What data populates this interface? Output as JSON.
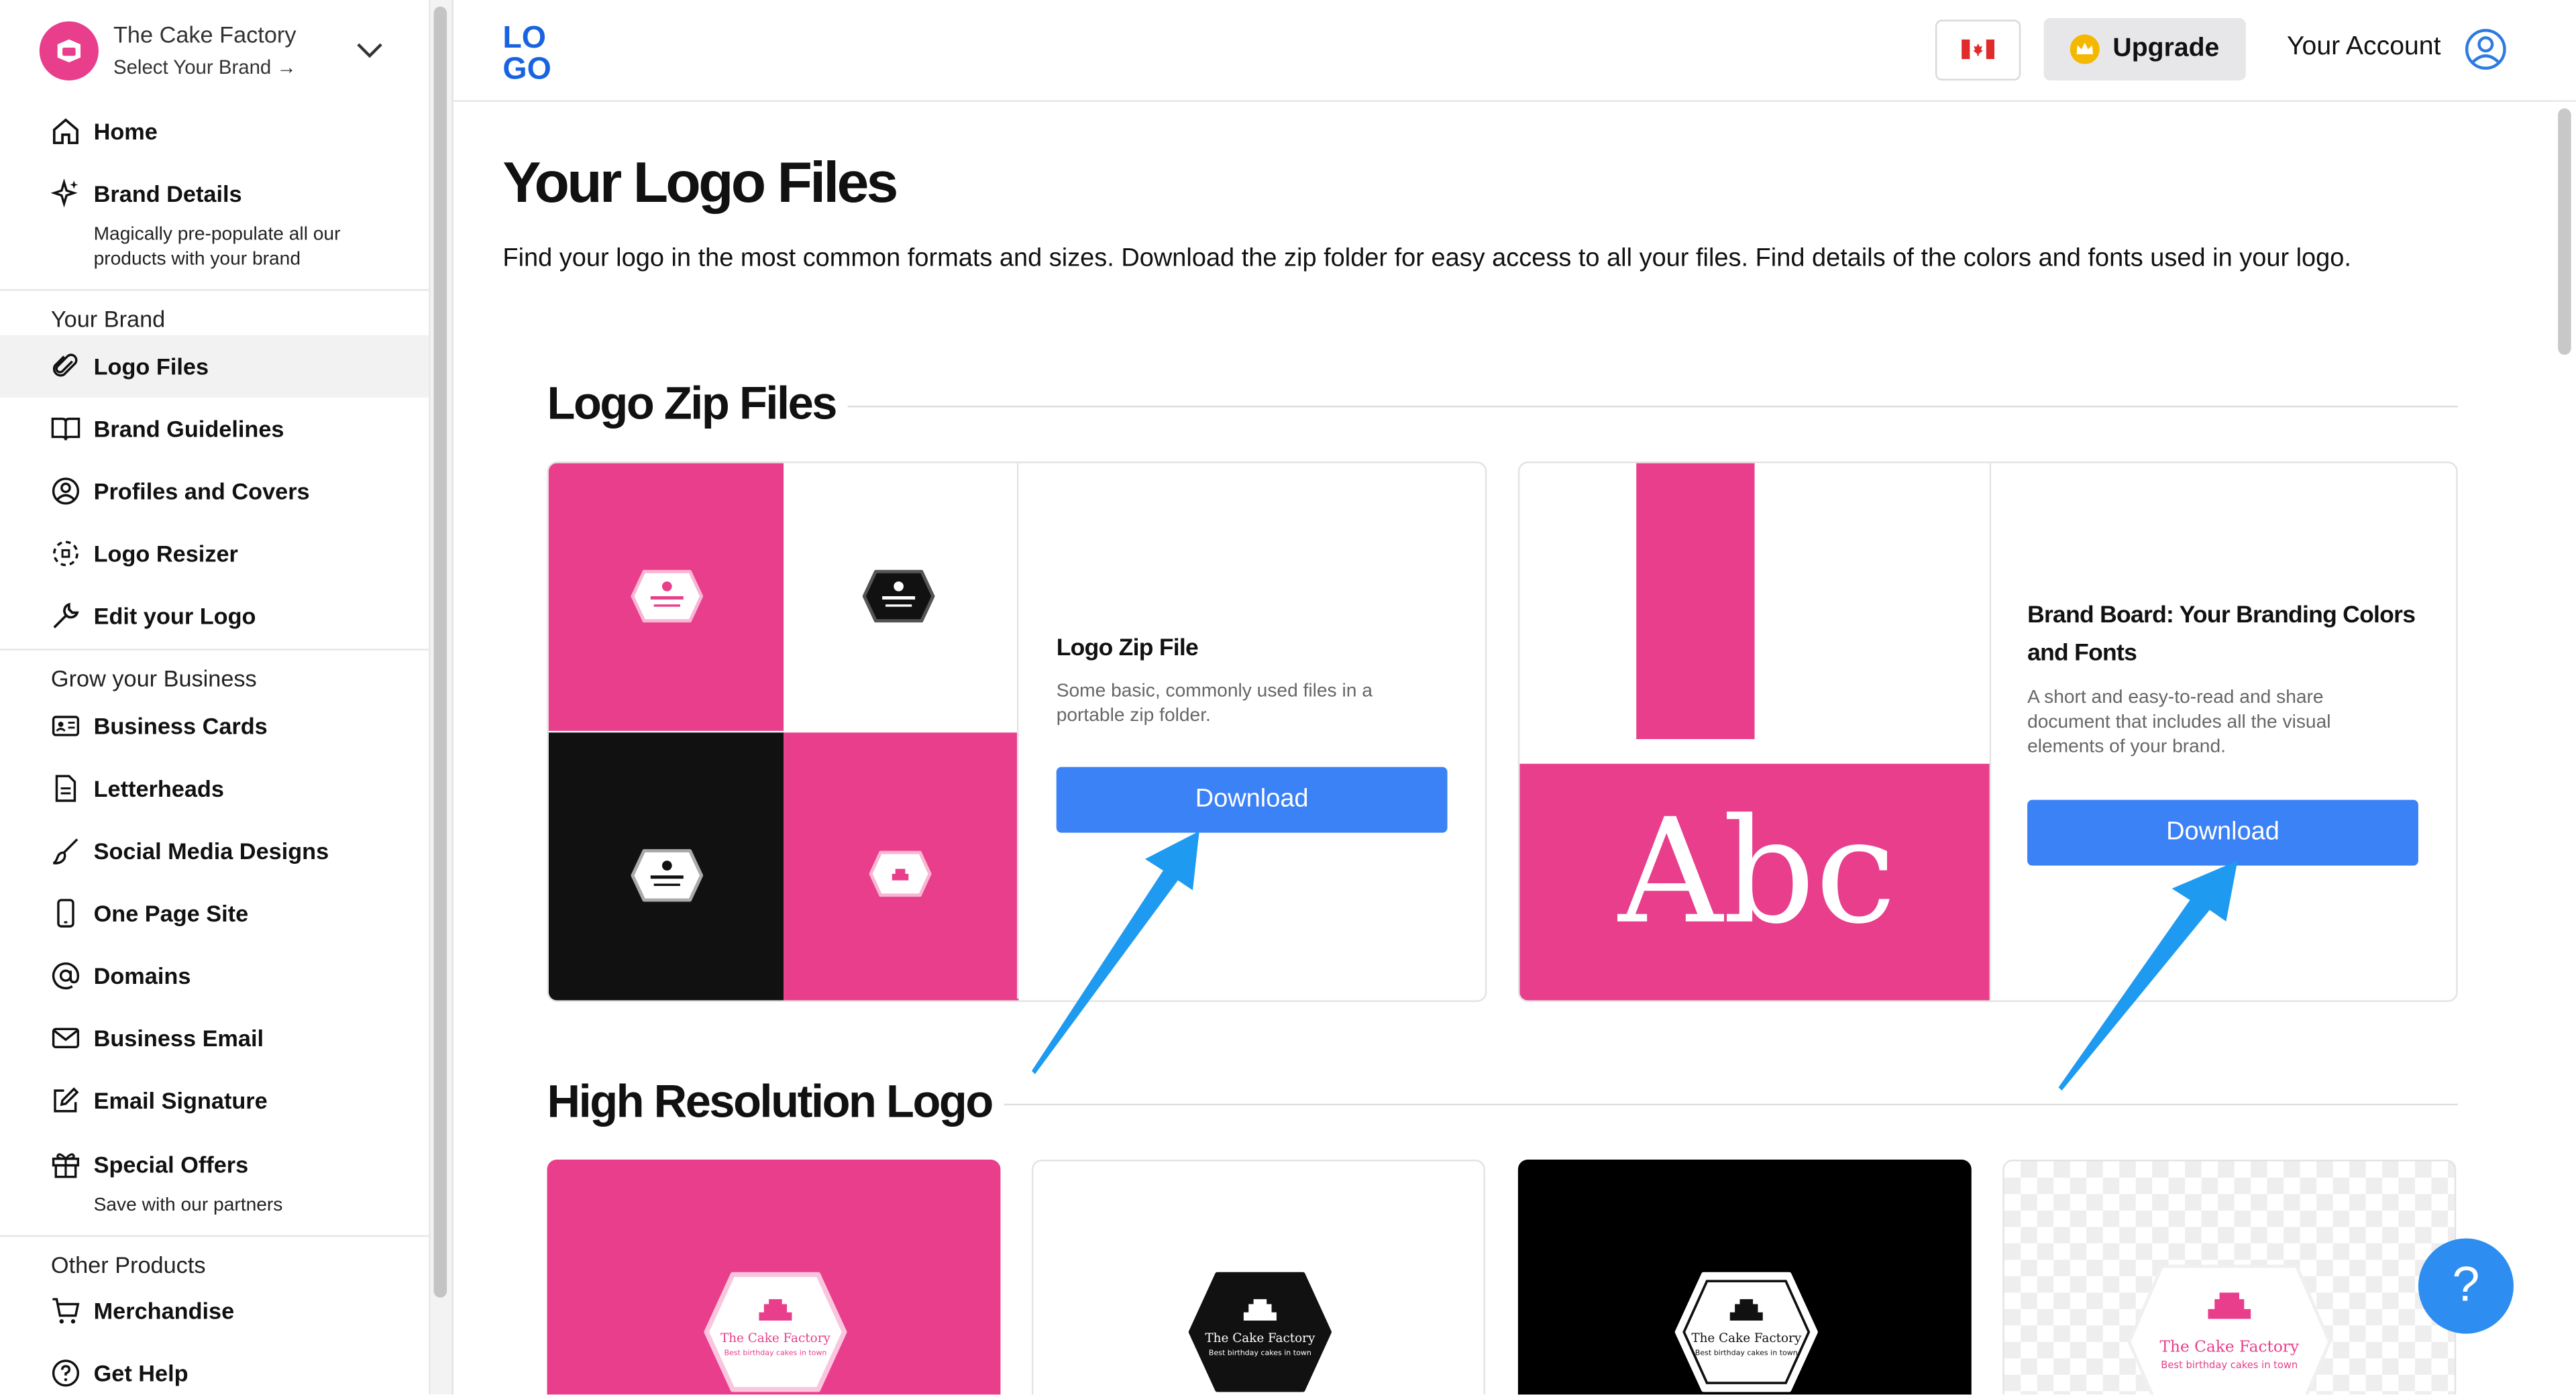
{
  "brand": {
    "name": "The Cake Factory",
    "select_label": "Select Your Brand →"
  },
  "nav": {
    "home": "Home",
    "brand_details": "Brand Details",
    "brand_details_desc": "Magically pre-populate all our products with your brand",
    "section_your_brand": "Your Brand",
    "logo_files": "Logo Files",
    "brand_guidelines": "Brand Guidelines",
    "profiles_covers": "Profiles and Covers",
    "logo_resizer": "Logo Resizer",
    "edit_logo": "Edit your Logo",
    "section_grow": "Grow your Business",
    "business_cards": "Business Cards",
    "letterheads": "Letterheads",
    "social_media": "Social Media Designs",
    "one_page_site": "One Page Site",
    "domains": "Domains",
    "business_email": "Business Email",
    "email_signature": "Email Signature",
    "special_offers": "Special Offers",
    "special_offers_desc": "Save with our partners",
    "section_other": "Other Products",
    "merchandise": "Merchandise",
    "get_help": "Get Help"
  },
  "header": {
    "logo_top": "LO",
    "logo_bottom": "GO",
    "upgrade_label": "Upgrade",
    "account_label": "Your Account"
  },
  "page": {
    "title": "Your Logo Files",
    "description": "Find your logo in the most common formats and sizes. Download the zip folder for easy access to all your files. Find details of the colors and fonts used in your logo."
  },
  "zip_section": {
    "title": "Logo Zip Files",
    "cards": [
      {
        "title": "Logo Zip File",
        "description": "Some basic, commonly used files in a portable zip folder.",
        "button": "Download"
      },
      {
        "title": "Brand Board: Your Branding Colors and Fonts",
        "description": "A short and easy-to-read and share document that includes all the visual elements of your brand.",
        "button": "Download",
        "preview_text": "Abc"
      }
    ]
  },
  "hires_section": {
    "title": "High Resolution Logo",
    "logo_name": "The Cake Factory",
    "logo_tagline": "Best birthday cakes in town"
  },
  "help_label": "?",
  "colors": {
    "brand_pink": "#e83e8c",
    "button_blue": "#3b82f6",
    "arrow_blue": "#1e9af0"
  }
}
